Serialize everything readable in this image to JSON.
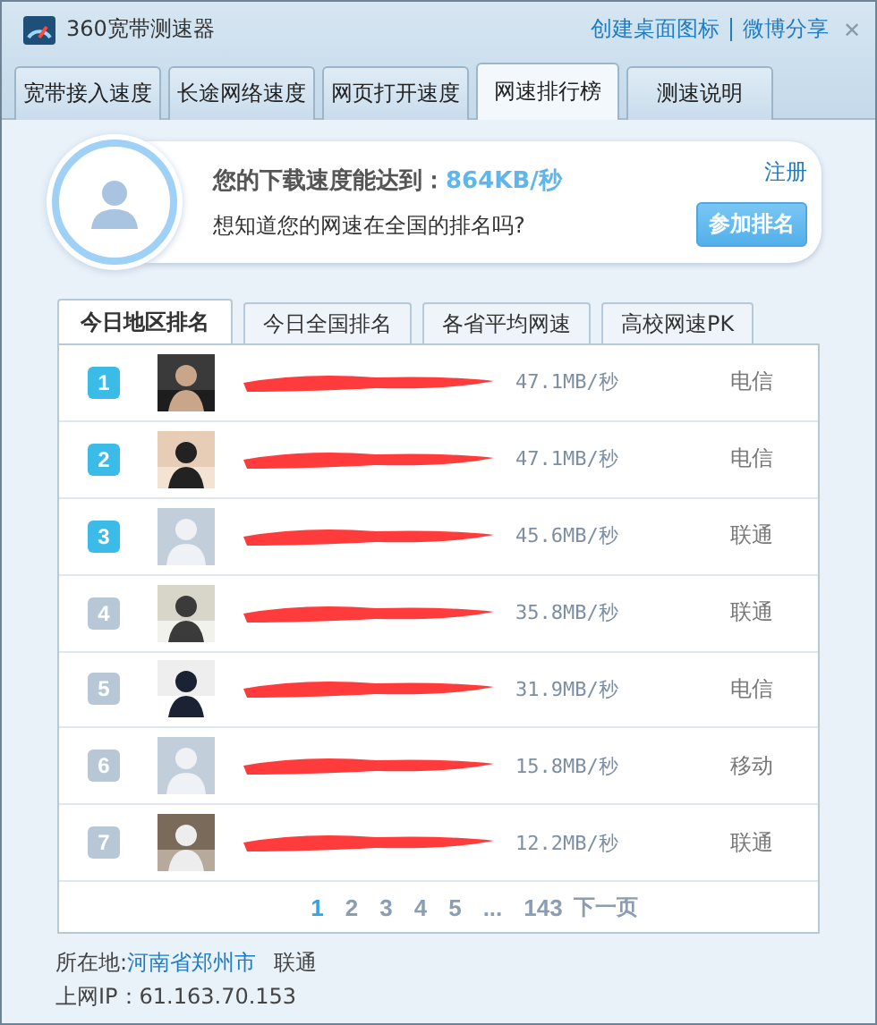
{
  "window": {
    "title": "360宽带测速器",
    "links": [
      "创建桌面图标",
      "微博分享"
    ],
    "close": "✕"
  },
  "tabs": [
    {
      "label": "宽带接入速度",
      "selected": false
    },
    {
      "label": "长途网络速度",
      "selected": false
    },
    {
      "label": "网页打开速度",
      "selected": false
    },
    {
      "label": "网速排行榜",
      "selected": true
    },
    {
      "label": "测速说明",
      "selected": false
    }
  ],
  "banner": {
    "speed_label": "您的下载速度能达到：",
    "speed_value": "864KB/秒",
    "question": "想知道您的网速在全国的排名吗?",
    "register_link": "注册",
    "join_button": "参加排名"
  },
  "ranking_tabs": [
    {
      "label": "今日地区排名",
      "selected": true
    },
    {
      "label": "今日全国排名",
      "selected": false
    },
    {
      "label": "各省平均网速",
      "selected": false
    },
    {
      "label": "高校网速PK",
      "selected": false
    }
  ],
  "rows": [
    {
      "rank": "1",
      "highlighted": true,
      "name_redacted": true,
      "speed": "47.1MB/秒",
      "isp": "电信"
    },
    {
      "rank": "2",
      "highlighted": true,
      "name_redacted": true,
      "speed": "47.1MB/秒",
      "isp": "电信"
    },
    {
      "rank": "3",
      "highlighted": true,
      "kind": "default",
      "name_redacted": true,
      "speed": "45.6MB/秒",
      "isp": "联通"
    },
    {
      "rank": "4",
      "highlighted": false,
      "name_redacted": true,
      "speed": "35.8MB/秒",
      "isp": "联通"
    },
    {
      "rank": "5",
      "highlighted": false,
      "name_redacted": true,
      "speed": "31.9MB/秒",
      "isp": "电信"
    },
    {
      "rank": "6",
      "highlighted": false,
      "kind": "default",
      "name_redacted": true,
      "speed": "15.8MB/秒",
      "isp": "移动"
    },
    {
      "rank": "7",
      "highlighted": false,
      "name_redacted": true,
      "speed": "12.2MB/秒",
      "isp": "联通"
    }
  ],
  "pagination": {
    "pages": [
      {
        "label": "1",
        "selected": true
      },
      {
        "label": "2",
        "selected": false
      },
      {
        "label": "3",
        "selected": false
      },
      {
        "label": "4",
        "selected": false
      },
      {
        "label": "5",
        "selected": false
      }
    ],
    "ellipsis": "...",
    "last": "143",
    "next": "下一页"
  },
  "footer": {
    "location_label": "所在地:",
    "location": "河南省郑州市",
    "isp": "联通",
    "ip": "上网IP：61.163.70.153"
  }
}
